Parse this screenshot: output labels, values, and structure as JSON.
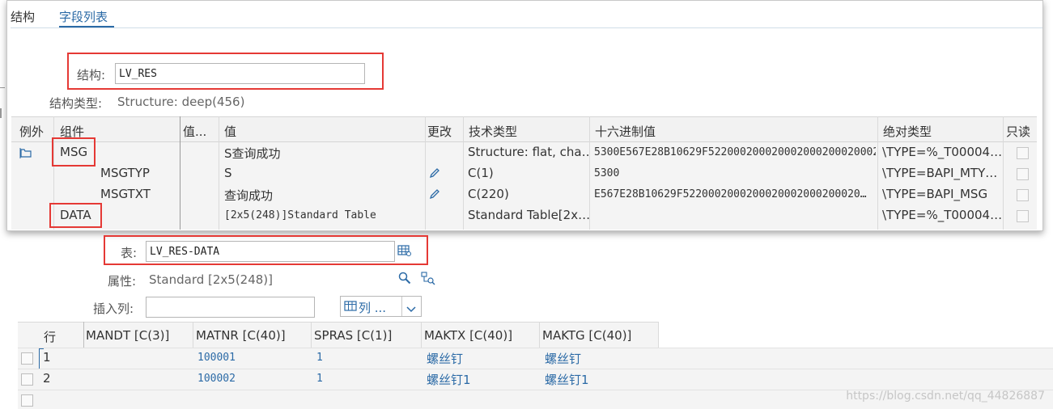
{
  "tabs": [
    "结构",
    "字段列表"
  ],
  "structure": {
    "label": "结构:",
    "value": "LV_RES",
    "type_label": "结构类型:",
    "type_value": "Structure: deep(456)"
  },
  "grid": {
    "headers": [
      "例外",
      "组件",
      "值...",
      "值",
      "更改",
      "技术类型",
      "十六进制值",
      "绝对类型",
      "只读"
    ],
    "rows": [
      {
        "component": "MSG",
        "value": "S查询成功",
        "tech": "Structure: flat, cha…",
        "hex": "5300E567E28B10629F5220002000200020002000200020…",
        "abs": "\\TYPE=%_T00004…",
        "editable": false
      },
      {
        "component": "MSGTYP",
        "value": "S",
        "tech": "C(1)",
        "hex": "5300",
        "abs": "\\TYPE=BAPI_MTY…",
        "editable": true
      },
      {
        "component": "MSGTXT",
        "value": "查询成功",
        "tech": "C(220)",
        "hex": "E567E28B10629F5220002000200020002000200020…",
        "abs": "\\TYPE=BAPI_MSG",
        "editable": true
      },
      {
        "component": "DATA",
        "value": "[2x5(248)]Standard Table",
        "tech": "Standard Table[2x…",
        "hex": "",
        "abs": "\\TYPE=%_T00004…",
        "editable": false
      }
    ]
  },
  "table_field": {
    "label": "表:",
    "value": "LV_RES-DATA",
    "attr_label": "属性:",
    "attr_value": "Standard [2x5(248)]",
    "insert_label": "插入列:",
    "insert_value": "",
    "columns_button": "列 ..."
  },
  "data_table": {
    "headers": [
      "行",
      "MANDT [C(3)]",
      "MATNR [C(40)]",
      "SPRAS [C(1)]",
      "MAKTX [C(40)]",
      "MAKTG [C(40)]"
    ],
    "rows": [
      {
        "row": "1",
        "mandt": "",
        "matnr": "100001",
        "spras": "1",
        "maktx": "螺丝钉",
        "maktg": "螺丝钉"
      },
      {
        "row": "2",
        "mandt": "",
        "matnr": "100002",
        "spras": "1",
        "maktx": "螺丝钉1",
        "maktg": "螺丝钉1"
      }
    ]
  },
  "watermark": "https://blog.csdn.net/qq_44826887",
  "colors": {
    "accent": "#2b6aa6",
    "highlight": "#e53935"
  },
  "icons": [
    "expand-node-icon",
    "pencil-icon",
    "table-view-icon",
    "magnifier-icon",
    "where-used-icon",
    "columns-icon",
    "dropdown-chevron-icon"
  ]
}
